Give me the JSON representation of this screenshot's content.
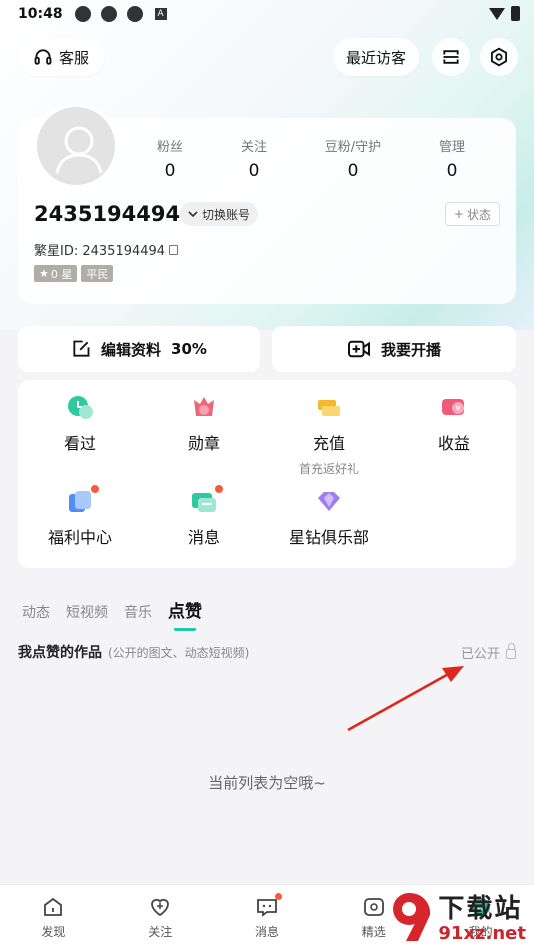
{
  "status_bar": {
    "time": "10:48",
    "a_label": "A"
  },
  "header": {
    "service_label": "客服",
    "visitor_label": "最近访客"
  },
  "profile": {
    "stats": [
      {
        "label": "粉丝",
        "value": "0"
      },
      {
        "label": "关注",
        "value": "0"
      },
      {
        "label": "豆粉/守护",
        "value": "0"
      },
      {
        "label": "管理",
        "value": "0"
      }
    ],
    "username": "2435194494",
    "switch_account_label": "切换账号",
    "status_label": "状态",
    "fanxing_id": "繁星ID: 2435194494",
    "star_badge": "0 星",
    "rank_badge": "平民"
  },
  "actions": {
    "edit_label": "编辑资料",
    "edit_progress": "30%",
    "live_label": "我要开播"
  },
  "grid": [
    {
      "label": "看过",
      "icon": "history-icon",
      "color": "#2fc8a0"
    },
    {
      "label": "勋章",
      "icon": "medal-icon",
      "color": "#f0657a"
    },
    {
      "label": "充值",
      "icon": "recharge-icon",
      "color": "#f5b82a",
      "sub": "首充返好礼"
    },
    {
      "label": "收益",
      "icon": "income-icon",
      "color": "#f25a7d"
    },
    {
      "label": "福利中心",
      "icon": "welfare-icon",
      "color": "#4e8ff4"
    },
    {
      "label": "消息",
      "icon": "message-icon",
      "color": "#2fc8a0"
    },
    {
      "label": "星钻俱乐部",
      "icon": "diamond-club-icon",
      "color": "#a07cf0"
    }
  ],
  "tabs": [
    "动态",
    "短视频",
    "音乐",
    "点赞"
  ],
  "active_tab": "点赞",
  "section": {
    "title": "我点赞的作品",
    "subtitle": "(公开的图文、动态短视频)",
    "public_status": "已公开"
  },
  "empty_text": "当前列表为空哦~",
  "bottom_nav": [
    {
      "label": "发现",
      "icon": "home-icon"
    },
    {
      "label": "关注",
      "icon": "heart-icon"
    },
    {
      "label": "消息",
      "icon": "chat-icon"
    },
    {
      "label": "精选",
      "icon": "featured-icon"
    },
    {
      "label": "我的",
      "icon": "profile-icon"
    }
  ],
  "watermark": {
    "cn": "下载站",
    "en": "91xz.net"
  }
}
